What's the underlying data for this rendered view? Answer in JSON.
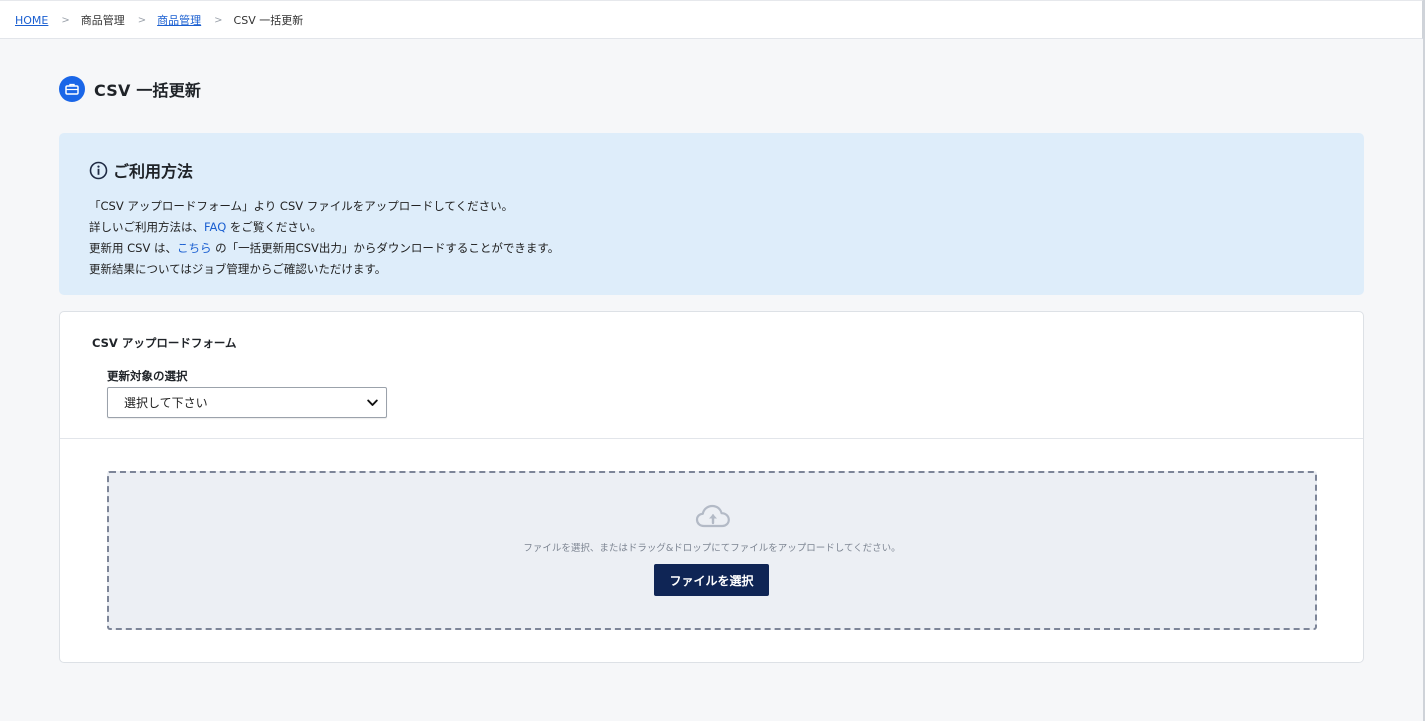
{
  "breadcrumb": {
    "items": [
      {
        "label": "HOME"
      },
      {
        "label": "商品管理"
      },
      {
        "label": "商品管理"
      },
      {
        "label": "CSV 一括更新"
      }
    ],
    "separator": ">"
  },
  "page": {
    "title": "CSV 一括更新"
  },
  "info": {
    "heading": "ご利用方法",
    "line1": "「CSV アップロードフォーム」より CSV ファイルをアップロードしてください。",
    "line2_pre": "詳しいご利用方法は、",
    "line2_link": "FAQ",
    "line2_post": " をご覧ください。",
    "line3_pre": "更新用 CSV は、",
    "line3_link": "こちら",
    "line3_post": " の「一括更新用CSV出力」からダウンロードすることができます。",
    "line4": "更新結果についてはジョブ管理からご確認いただけます。"
  },
  "form": {
    "header": "CSV アップロードフォーム",
    "select_label": "更新対象の選択",
    "select_value": "選択して下さい",
    "drop_text": "ファイルを選択、またはドラッグ&ドロップにてファイルをアップロードしてください。",
    "button_label": "ファイルを選択"
  },
  "icons": {
    "title": "briefcase-icon",
    "info": "info-circle-icon",
    "upload": "cloud-upload-icon",
    "select": "chevron-down-icon"
  },
  "colors": {
    "accent": "#1a66e8",
    "link": "#1a5fd1",
    "info_bg": "#deedfa",
    "button_bg": "#0f2555"
  }
}
